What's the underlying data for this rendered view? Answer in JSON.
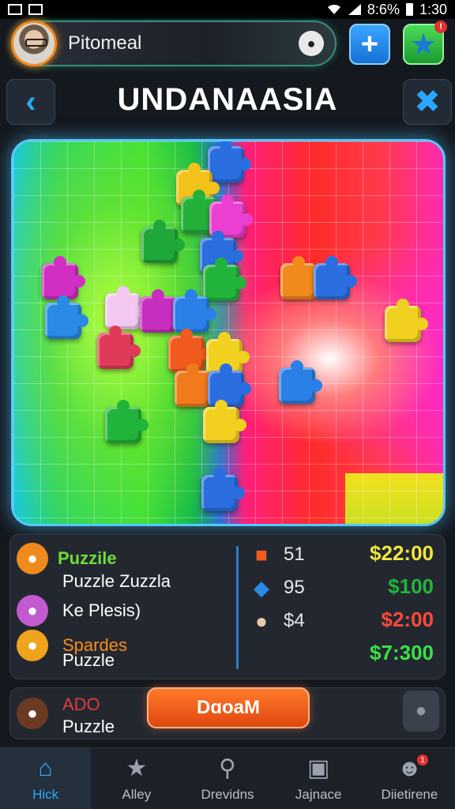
{
  "status_bar": {
    "battery": "8:6%",
    "time": "1:30"
  },
  "profile": {
    "name": "Pitomeal"
  },
  "header": {
    "title": "UNDANAASIA"
  },
  "colors": {
    "accent": "#2aa8ff",
    "play_button": "#f0661c",
    "board_border": "#54c8ff"
  },
  "stats": {
    "left": [
      {
        "title": "Puzzile",
        "title_color": "#6fdc3c",
        "subtitle": "Puzzle Zuzzla"
      },
      {
        "title": "",
        "subtitle": "Ke Plesis)"
      },
      {
        "title": "Spardes",
        "title_color": "#ff8a1c",
        "subtitle": "Puzzle"
      }
    ],
    "counts": [
      {
        "icon": "puzzle-piece-icon",
        "value": "51"
      },
      {
        "icon": "gem-icon",
        "value": "95"
      },
      {
        "icon": "cookie-icon",
        "value": "$4"
      }
    ],
    "prices": [
      {
        "value": "$22:00",
        "color": "#f2e63a"
      },
      {
        "value": "$100",
        "color": "#22b43a"
      },
      {
        "value": "$2:00",
        "color": "#ff4a3a"
      },
      {
        "value": "$7:300",
        "color": "#3ae048"
      }
    ]
  },
  "action": {
    "title": "ADO",
    "subtitle": "Puzzle",
    "button_label": "DɑoaM"
  },
  "nav": [
    {
      "label": "Hick",
      "icon": "home-icon",
      "active": true
    },
    {
      "label": "Alley",
      "icon": "star-icon",
      "active": false
    },
    {
      "label": "Drevidns",
      "icon": "search-icon",
      "active": false
    },
    {
      "label": "Jajnace",
      "icon": "briefcase-icon",
      "active": false
    },
    {
      "label": "Diietirene",
      "icon": "profile-icon",
      "active": false
    }
  ]
}
